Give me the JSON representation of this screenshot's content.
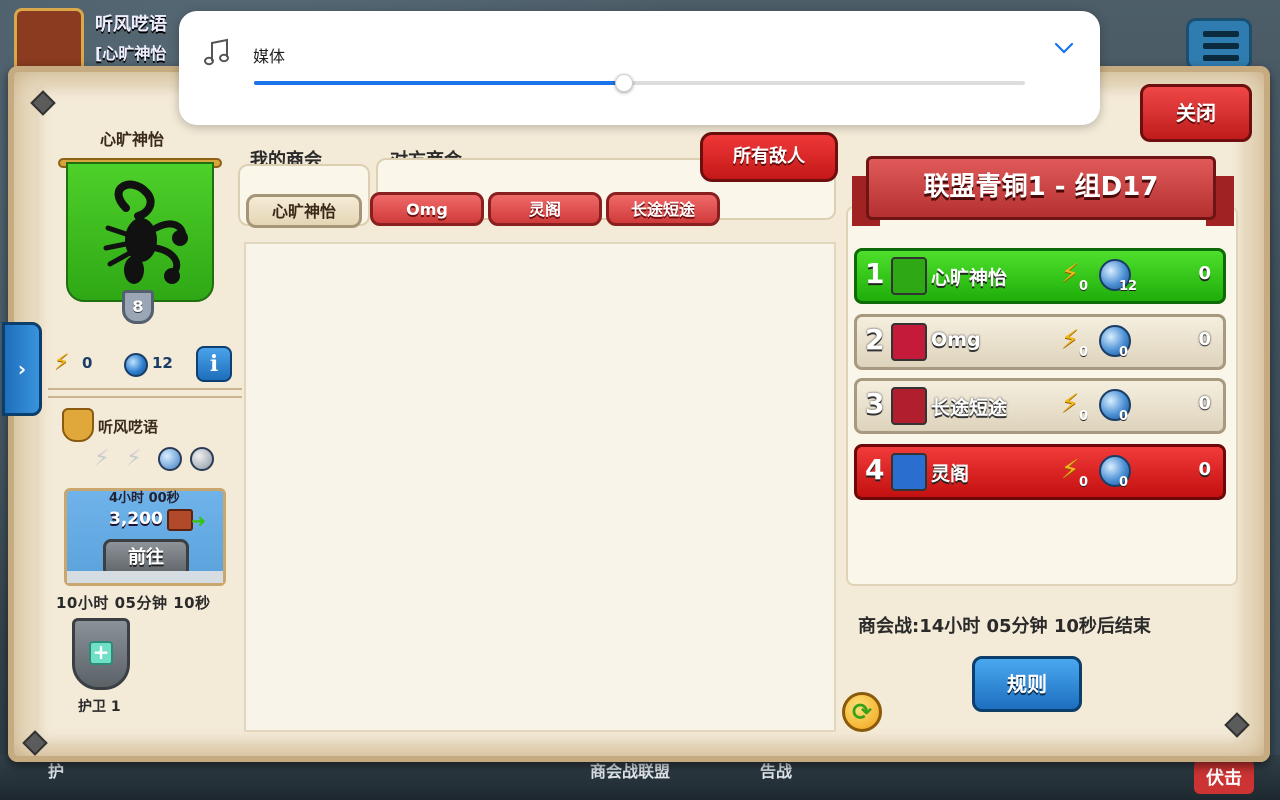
{
  "background": {
    "title": "听风呓语",
    "subtitle": "[心旷神怡",
    "bottom_labels": [
      "护",
      "商会战联盟",
      "告战",
      "伏击"
    ]
  },
  "volume_overlay": {
    "label": "媒体",
    "level_percent": 48,
    "icon": "music-note-icon",
    "expand_icon": "chevron-down-icon",
    "accent_color": "#1a73e8"
  },
  "close_label": "关闭",
  "my_clan": {
    "name": "心旷神怡",
    "level": "8",
    "bolts": "0",
    "globes": "12",
    "info_icon": "i"
  },
  "opponent_preview": {
    "name": "听风呓语",
    "reward_time": "4小时 00秒",
    "reward_amount": "3,200",
    "goto_label": "前往",
    "timer": "10小时  05分钟  10秒",
    "guard_label": "护卫 1"
  },
  "tabs": {
    "mine_label": "我的商会",
    "enemy_label": "对方商会",
    "mine_clan": "心旷神怡",
    "enemy_clans": [
      "Omg",
      "灵阁",
      "长途短途"
    ],
    "all_enemies": "所有敌人"
  },
  "league": {
    "title": "联盟青铜1 - 组D17",
    "rows": [
      {
        "rank": "1",
        "name": "心旷神怡",
        "bolts": "0",
        "globes": "12",
        "score": "0",
        "style": "green",
        "crest_color": "#2fa815"
      },
      {
        "rank": "2",
        "name": "Omg",
        "bolts": "0",
        "globes": "0",
        "score": "0",
        "style": "grey",
        "crest_color": "#c41b3a"
      },
      {
        "rank": "3",
        "name": "长途短途",
        "bolts": "0",
        "globes": "0",
        "score": "0",
        "style": "grey",
        "crest_color": "#b11e2e"
      },
      {
        "rank": "4",
        "name": "灵阁",
        "bolts": "0",
        "globes": "0",
        "score": "0",
        "style": "red",
        "crest_color": "#2a6fd0"
      }
    ]
  },
  "war_timer": "商会战:14小时  05分钟  10秒后结束",
  "rules_label": "规则"
}
